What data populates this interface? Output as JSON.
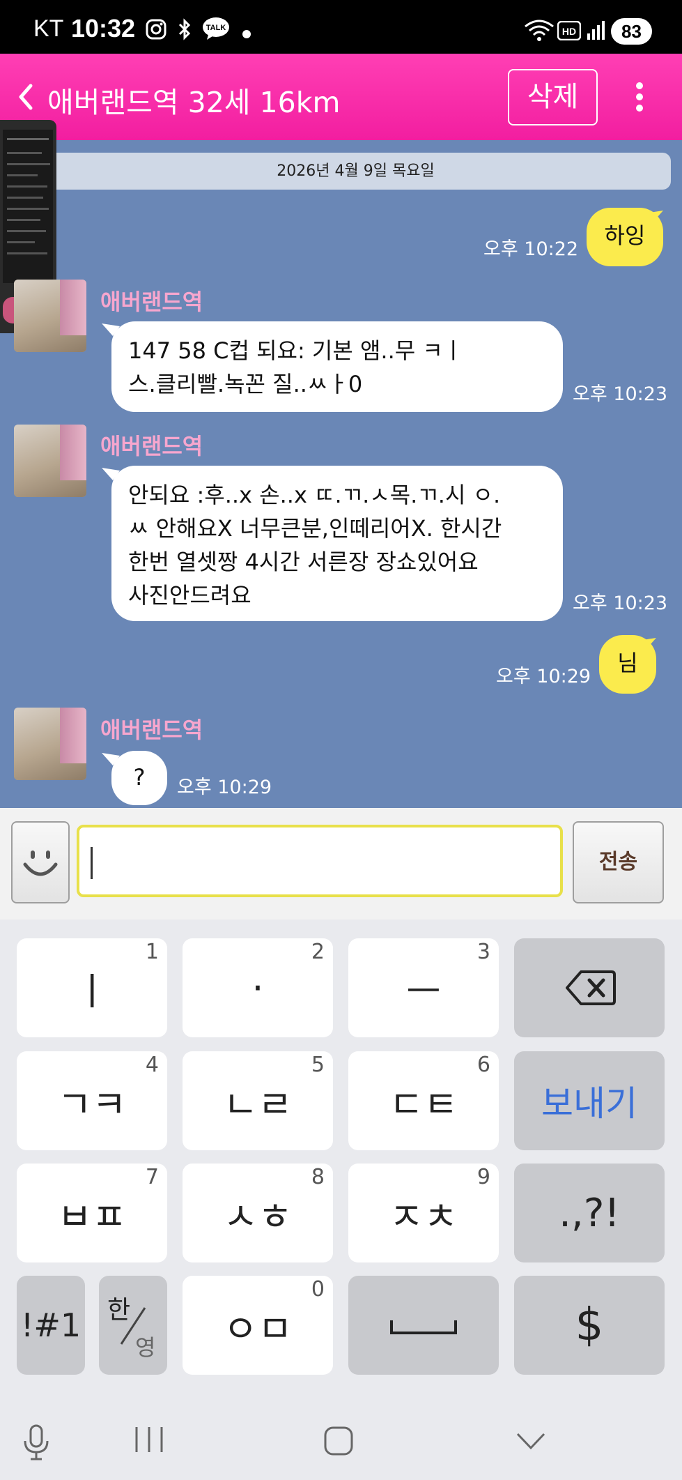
{
  "status_bar": {
    "carrier": "KT",
    "time": "10:32",
    "battery": "83"
  },
  "header": {
    "title": "애버랜드역 32세 16km",
    "delete_label": "삭제"
  },
  "date_divider": "2026년 4월 9일 목요일",
  "messages": [
    {
      "from": "me",
      "lines": [
        "하잉"
      ],
      "time": "오후 10:22"
    },
    {
      "from": "other",
      "sender": "애버랜드역",
      "lines": [
        "147 58  C컵  되요: 기본 앰..무 ㅋㅣ",
        "스.클리빨.녹꼰 질..ㅆㅏ0"
      ],
      "time": "오후 10:23"
    },
    {
      "from": "other",
      "sender": "애버랜드역",
      "lines": [
        "안되요 :후..x 손..x ㄸ.ㄲ.ㅅ목.ㄲ.시     ㅇ.",
        "ㅆ 안해요X 너무큰분,인떼리어X. 한시간",
        "한번 열셋짱 4시간 서른장 장쇼있어요",
        "사진안드려요"
      ],
      "time": "오후 10:23"
    },
    {
      "from": "me",
      "lines": [
        "님"
      ],
      "time": "오후 10:29"
    },
    {
      "from": "other",
      "sender": "애버랜드역",
      "lines": [
        "?"
      ],
      "time": "오후 10:29"
    }
  ],
  "input": {
    "placeholder": "",
    "send_label": "전송"
  },
  "keyboard": {
    "row1": [
      {
        "label": "ㅣ",
        "num": "1"
      },
      {
        "label": "·",
        "num": "2"
      },
      {
        "label": "ㅡ",
        "num": "3"
      }
    ],
    "row2": [
      {
        "label": "ㄱㅋ",
        "num": "4"
      },
      {
        "label": "ㄴㄹ",
        "num": "5"
      },
      {
        "label": "ㄷㅌ",
        "num": "6"
      }
    ],
    "row3": [
      {
        "label": "ㅂㅍ",
        "num": "7"
      },
      {
        "label": "ㅅㅎ",
        "num": "8"
      },
      {
        "label": "ㅈㅊ",
        "num": "9"
      }
    ],
    "row4_zero": {
      "label": "ㅇㅁ",
      "num": "0"
    },
    "send_key": "보내기",
    "punct_key": ".,?!",
    "symbol_key": "!#1",
    "lang_key_top": "한",
    "lang_key_bottom": "영",
    "dollar_key": "$"
  },
  "icons": {
    "status": [
      "instagram-icon",
      "bluetooth-icon",
      "talk-icon",
      "dot-icon",
      "wifi-icon",
      "hd-icon",
      "signal-icon"
    ],
    "nav": [
      "mic-icon",
      "recents-icon",
      "home-icon",
      "back-icon"
    ]
  },
  "colors": {
    "header": "#f21ea0",
    "chat_bg": "#6a87b6",
    "my_bubble": "#fbeb4d",
    "sender_name": "#f7a6ce",
    "send_key": "#3a6fd8"
  }
}
